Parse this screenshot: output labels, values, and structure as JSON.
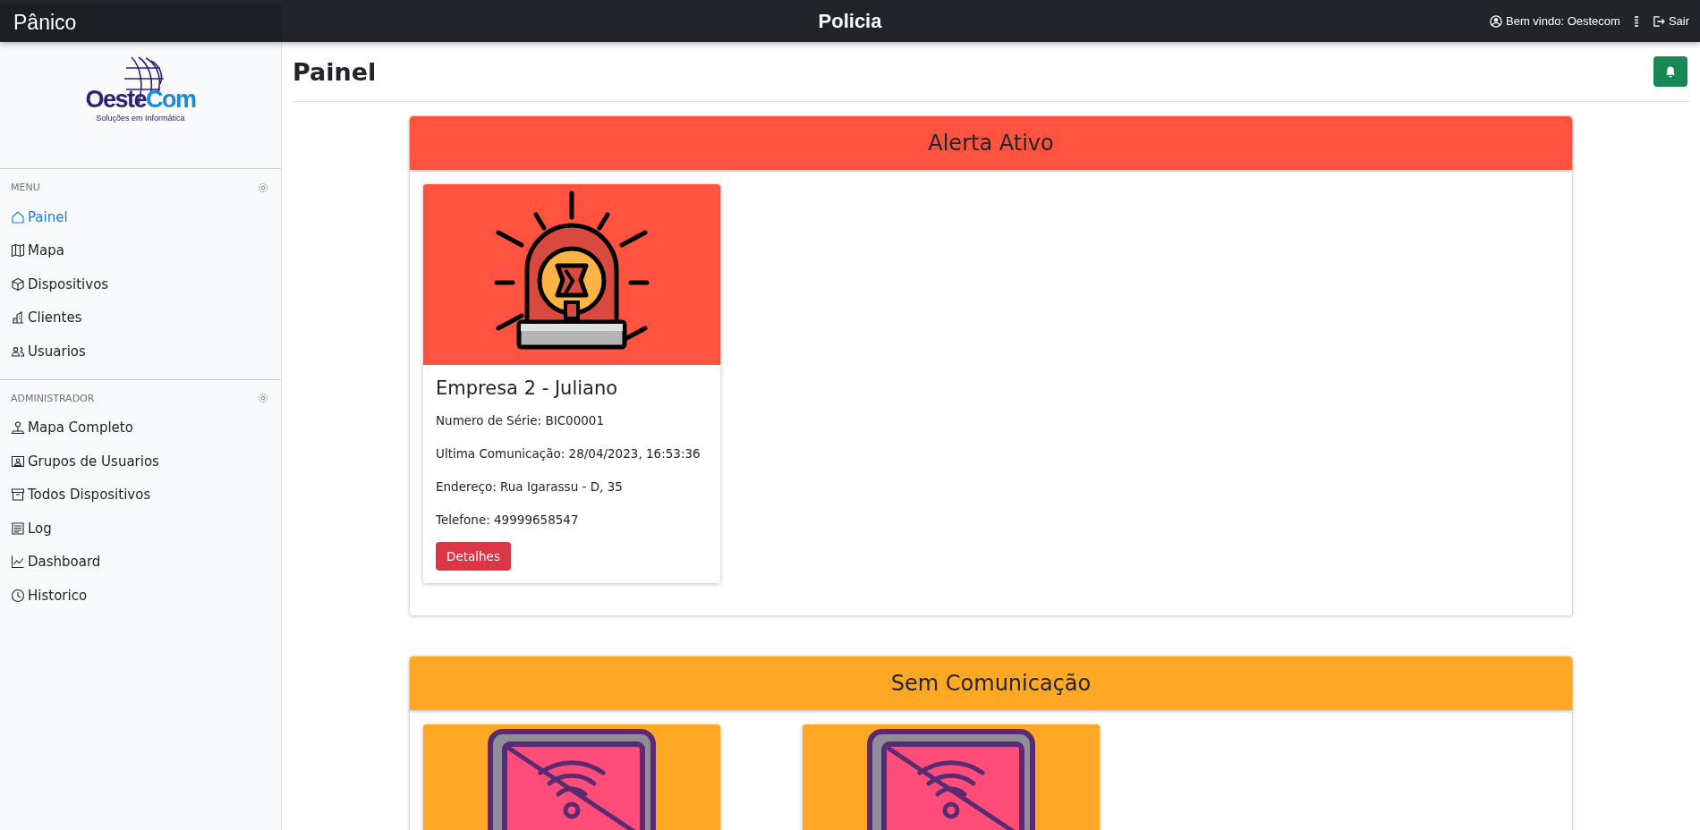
{
  "topbar": {
    "brand": "Pânico",
    "title": "Policia",
    "user_label": "Bem vindo: Oestecom",
    "logout": "Sair"
  },
  "logo": {
    "wordmark": [
      "Oeste",
      "Com"
    ],
    "tagline": "Soluções em Informática"
  },
  "sidebar": {
    "sections": [
      {
        "title": "MENU",
        "items": [
          {
            "label": "Painel",
            "selected": true
          },
          {
            "label": "Mapa",
            "selected": false
          },
          {
            "label": "Dispositivos",
            "selected": false
          },
          {
            "label": "Clientes",
            "selected": false
          },
          {
            "label": "Usuarios",
            "selected": false
          }
        ]
      },
      {
        "title": "ADMINISTRADOR",
        "items": [
          {
            "label": "Mapa Completo",
            "selected": false
          },
          {
            "label": "Grupos de Usuarios",
            "selected": false
          },
          {
            "label": "Todos Dispositivos",
            "selected": false
          },
          {
            "label": "Log",
            "selected": false
          },
          {
            "label": "Dashboard",
            "selected": false
          },
          {
            "label": "Historico",
            "selected": false
          }
        ]
      }
    ]
  },
  "page_title": "Painel",
  "sections": [
    {
      "title": "Alerta Ativo",
      "color": "#ff5340",
      "cards": [
        {
          "kind": "alert",
          "title": "Empresa 2 - Juliano",
          "details": [
            "Numero de Série: BIC00001",
            "Ultima Comunicação: 28/04/2023, 16:53:36",
            "Endereço: Rua Igarassu - D, 35",
            "Telefone: 49999658547"
          ],
          "button": "Detalhes"
        }
      ]
    },
    {
      "title": "Sem Comunicação",
      "color": "#ffa826",
      "cards": [
        {
          "kind": "offline"
        },
        {
          "kind": "offline"
        }
      ]
    }
  ]
}
